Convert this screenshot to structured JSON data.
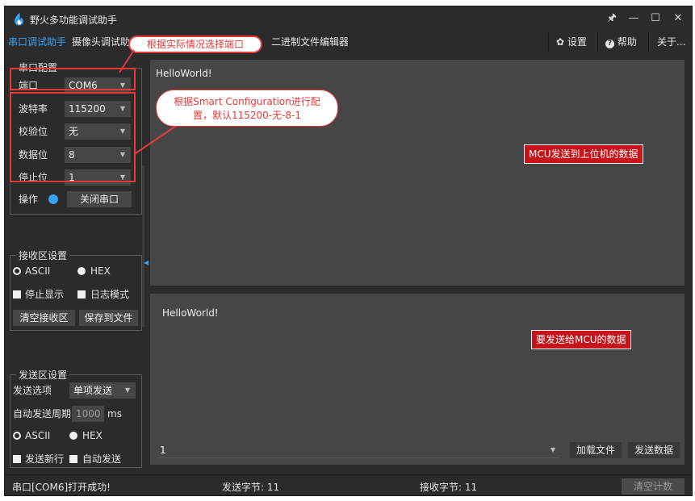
{
  "window": {
    "title": "野火多功能调试助手",
    "controls": {
      "pin": "🖈",
      "minimize": "—",
      "maximize": "☐",
      "close": "✕"
    }
  },
  "menu": {
    "tabs": [
      {
        "label": "串口调试助手",
        "active": true
      },
      {
        "label": "摄像头调试助手",
        "active": false
      },
      {
        "label": "二进制文件编辑器",
        "active": false
      }
    ],
    "settings": "设置",
    "help": "帮助",
    "about": "关于..."
  },
  "serial_config": {
    "group_title": "串口配置",
    "port_label": "端口",
    "port_value": "COM6",
    "baud_label": "波特率",
    "baud_value": "115200",
    "parity_label": "校验位",
    "parity_value": "无",
    "databits_label": "数据位",
    "databits_value": "8",
    "stopbits_label": "停止位",
    "stopbits_value": "1",
    "operate_label": "操作",
    "close_port_label": "关闭串口"
  },
  "recv_settings": {
    "group_title": "接收区设置",
    "ascii": "ASCII",
    "hex": "HEX",
    "stop_display": "停止显示",
    "log_mode": "日志模式",
    "clear_recv": "清空接收区",
    "save_to_file": "保存到文件"
  },
  "send_settings": {
    "group_title": "发送区设置",
    "send_option_label": "发送选项",
    "send_option_value": "单项发送",
    "auto_period_label": "自动发送周期",
    "auto_period_value": "1000",
    "auto_period_unit": "ms",
    "ascii": "ASCII",
    "hex": "HEX",
    "send_newline": "发送新行",
    "auto_send": "自动发送"
  },
  "recv_area": {
    "text": "HelloWorld!"
  },
  "send_area": {
    "text": "HelloWorld!",
    "history_value": "1",
    "load_file": "加载文件",
    "send_data": "发送数据"
  },
  "status_bar": {
    "message": "串口[COM6]打开成功!",
    "sent_bytes": "发送字节: 11",
    "recv_bytes": "接收字节: 11",
    "clear_count": "清空计数"
  },
  "annotations": {
    "port_callout": "根据实际情况选择端口",
    "config_callout_line1": "根据Smart Configuration进行配",
    "config_callout_line2": "置，默认115200-无-8-1",
    "recv_label": "MCU发送到上位机的数据",
    "send_label": "要发送给MCU的数据"
  },
  "colors": {
    "accent": "#3aa0f0",
    "annotation": "#e53a3a",
    "label_fill": "#c6141b"
  }
}
